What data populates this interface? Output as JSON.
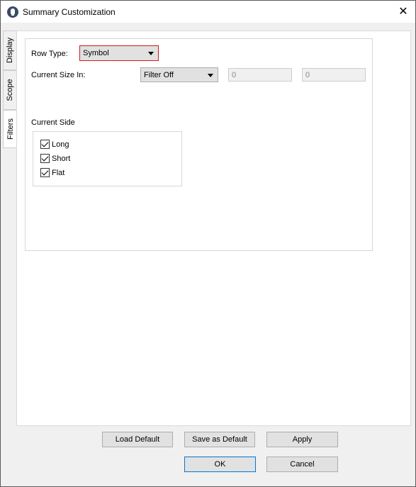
{
  "window": {
    "title": "Summary Customization",
    "close_glyph": "✕"
  },
  "tabs": [
    {
      "label": "Display",
      "active": false
    },
    {
      "label": "Scope",
      "active": false
    },
    {
      "label": "Filters",
      "active": true
    }
  ],
  "filters": {
    "row_type_label": "Row Type:",
    "row_type_value": "Symbol",
    "current_size_label": "Current Size In:",
    "current_size_value": "Filter Off",
    "size_min": "0",
    "size_max": "0",
    "current_side_label": "Current Side",
    "sides": [
      {
        "label": "Long",
        "checked": true
      },
      {
        "label": "Short",
        "checked": true
      },
      {
        "label": "Flat",
        "checked": true
      }
    ]
  },
  "buttons": {
    "load_default": "Load Default",
    "save_default": "Save as Default",
    "apply": "Apply",
    "ok": "OK",
    "cancel": "Cancel"
  },
  "colors": {
    "highlight_border": "#d11a1a",
    "default_button_border": "#0078d7"
  },
  "icons": {
    "app": "app-logo-icon",
    "close": "close-icon",
    "dropdown": "chevron-down-icon"
  }
}
